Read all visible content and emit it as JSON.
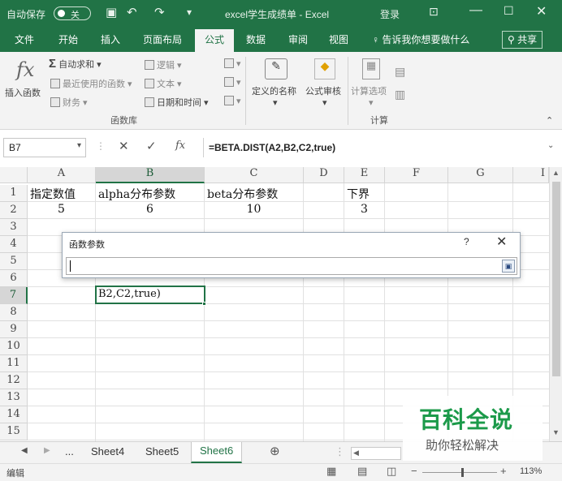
{
  "titlebar": {
    "autosave_label": "自动保存",
    "autosave_state": "关",
    "filename": "excel学生成绩单",
    "separator": "-",
    "app_name": "Excel",
    "login_label": "登录"
  },
  "tabs": [
    "文件",
    "开始",
    "插入",
    "页面布局",
    "公式",
    "数据",
    "审阅",
    "视图"
  ],
  "active_tab": "公式",
  "tell_me": "告诉我你想要做什么",
  "share_label": "共享",
  "ribbon": {
    "insert_function": "插入函数",
    "autosum": "自动求和",
    "recently_used": "最近使用的函数",
    "financial": "财务",
    "logical": "逻辑",
    "text": "文本",
    "date_time": "日期和时间",
    "group_function_library": "函数库",
    "defined_names": "定义的名称",
    "formula_auditing": "公式审核",
    "calc_options": "计算选项",
    "group_calculation": "计算"
  },
  "formula_bar": {
    "name_box": "B7",
    "formula": "=BETA.DIST(A2,B2,C2,true)"
  },
  "columns": [
    "A",
    "B",
    "C",
    "D",
    "E",
    "F",
    "G",
    "I"
  ],
  "rows": [
    "1",
    "2",
    "3",
    "4",
    "5",
    "6",
    "7",
    "8",
    "9",
    "10",
    "11",
    "12",
    "13",
    "14",
    "15"
  ],
  "cells": {
    "A1": "指定数值",
    "B1": "alpha分布参数",
    "C1": "beta分布参数",
    "E1": "下界",
    "A2": "5",
    "B2": "6",
    "C2": "10",
    "E2": "3",
    "B7": "B2,C2,true)"
  },
  "dialog": {
    "title": "函数参数",
    "help": "?",
    "close": "✕",
    "input_value": ""
  },
  "sheets": [
    "Sheet4",
    "Sheet5",
    "Sheet6"
  ],
  "active_sheet": "Sheet6",
  "sheet_ellipsis": "...",
  "status": {
    "mode": "编辑",
    "zoom": "113%"
  },
  "watermark": {
    "main": "百科全说",
    "sub": "助你轻松解决"
  },
  "colors": {
    "excel_green": "#217346",
    "watermark_green": "#1c9a4a"
  }
}
